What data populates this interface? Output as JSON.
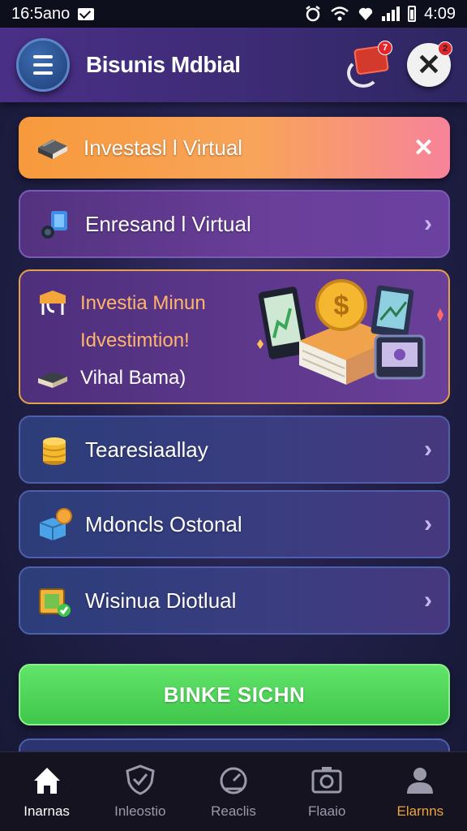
{
  "status_bar": {
    "time_left": "16:5ano",
    "time_right": "4:09"
  },
  "header": {
    "title": "Bisunis Mdbial",
    "notif_badge": "7",
    "close_badge": "2"
  },
  "cards": {
    "orange": {
      "label": "Investasl l Virtual"
    },
    "purple": {
      "label": "Enresand l Virtual"
    },
    "feature": {
      "line1": "Investia Minun",
      "line2": "Idvestimtion!",
      "line3": "Vihal Bama)"
    },
    "list": [
      {
        "label": "Tearesiaallay"
      },
      {
        "label": "Mdoncls Ostonal"
      },
      {
        "label": "Wisinua Diotlual"
      }
    ]
  },
  "cta": {
    "label": "BINKE SICHN"
  },
  "bottom_nav": {
    "items": [
      {
        "label": "Inarnas"
      },
      {
        "label": "Inleostio"
      },
      {
        "label": "Reaclis"
      },
      {
        "label": "Flaaio"
      },
      {
        "label": "Elarnns"
      }
    ]
  },
  "colors": {
    "accent_green": "#3fc64b",
    "accent_orange": "#f79a3c",
    "nav_active_gold": "#f0a33a"
  }
}
